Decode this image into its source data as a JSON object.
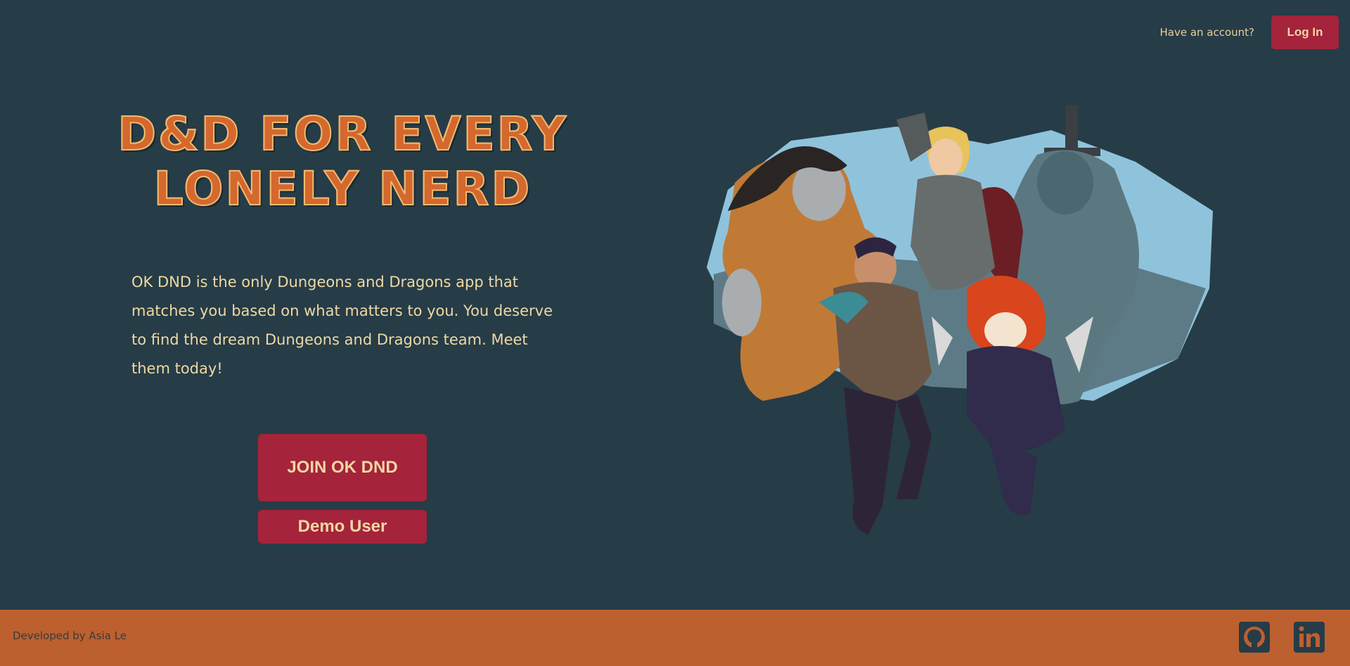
{
  "header": {
    "have_account_text": "Have an account?",
    "login_label": "Log In"
  },
  "hero": {
    "title_line1": "D&D FOR EVERY",
    "title_line2": "LONELY NERD",
    "description": "OK DND is the only Dungeons and Dragons app that matches you based on what matters to you. You deserve to find the dream Dungeons and Dragons team. Meet them today!",
    "join_label": "JOIN OK DND",
    "demo_label": "Demo User",
    "image_icon": "adventuring-party-illustration"
  },
  "footer": {
    "credit": "Developed by Asia Le",
    "links": [
      {
        "icon": "github-icon"
      },
      {
        "icon": "linkedin-icon"
      }
    ]
  },
  "colors": {
    "background": "#263c47",
    "accent_button": "#a5233b",
    "button_text": "#f0d7a3",
    "title_fill": "#d4682f",
    "footer": "#bd6030"
  }
}
